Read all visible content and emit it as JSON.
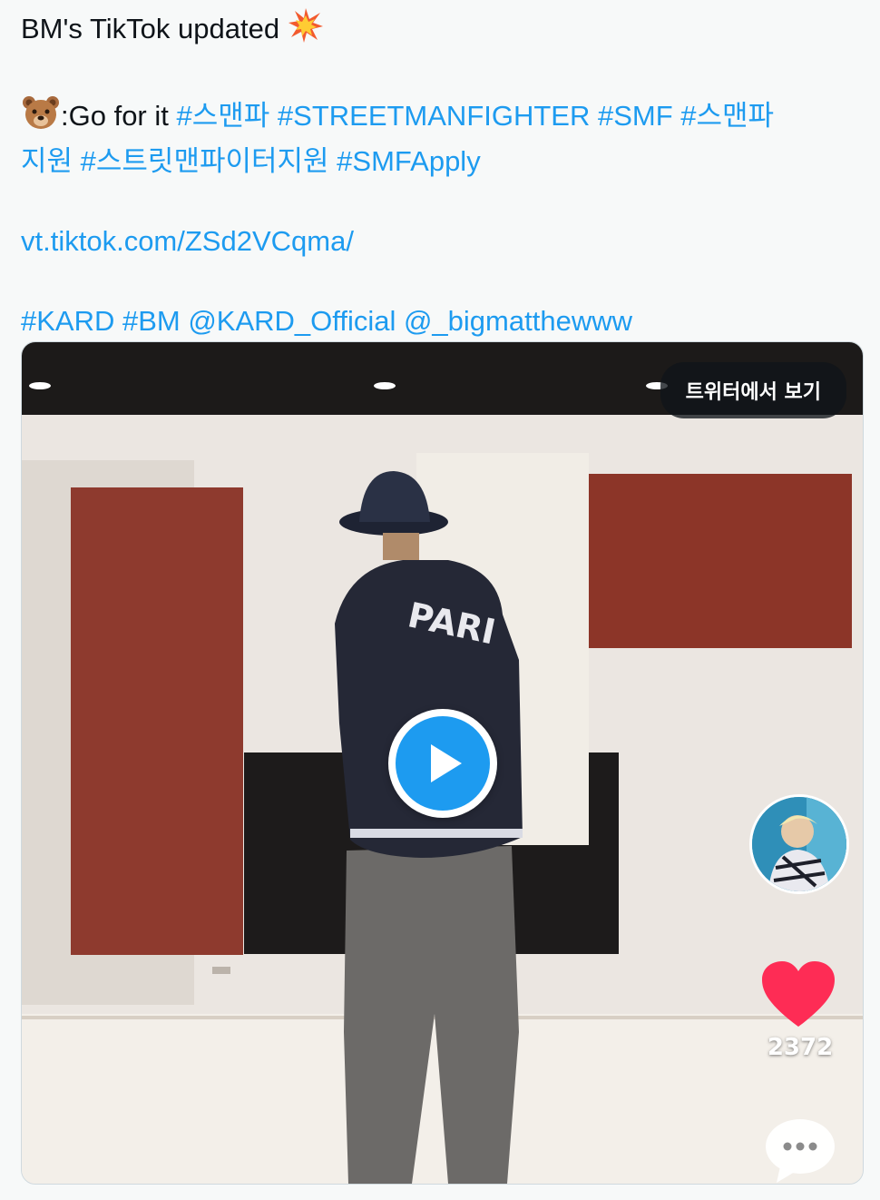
{
  "tweet": {
    "title": "BM's TikTok updated",
    "title_emoji": "collision-icon",
    "line2_prefix": ":Go for it ",
    "line2_emoji": "bear-face-icon",
    "hashtags_line2": "#스맨파 #STREETMANFIGHTER #SMF #스맨파",
    "hashtags_line3": "지원 #스트릿맨파이터지원 #SMFApply",
    "link": "vt.tiktok.com/ZSd2VCqma/",
    "mentions": "#KARD #BM @KARD_Official @_bigmatthewww"
  },
  "media": {
    "view_button_label": "트위터에서 보기",
    "like_count": "2372",
    "icons": [
      "play-icon",
      "heart-icon",
      "comment-icon",
      "avatar"
    ]
  },
  "colors": {
    "link": "#1d9bf0",
    "background": "#f7f9f9",
    "heart": "#fe2c55"
  }
}
